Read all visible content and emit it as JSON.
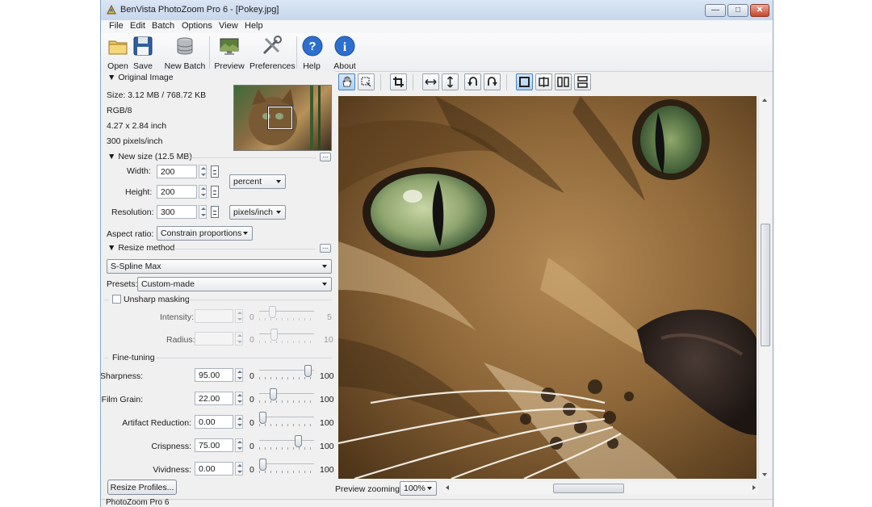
{
  "window": {
    "title": "BenVista PhotoZoom Pro 6 - [Pokey.jpg]"
  },
  "menu": [
    "File",
    "Edit",
    "Batch",
    "Options",
    "View",
    "Help"
  ],
  "toolbar": [
    {
      "label": "Open",
      "icon": "folder-icon"
    },
    {
      "label": "Save",
      "icon": "floppy-disk-icon"
    },
    {
      "label": "New Batch",
      "icon": "batch-stack-icon"
    },
    {
      "label": "Preview",
      "icon": "preview-monitor-icon"
    },
    {
      "label": "Preferences",
      "icon": "tools-icon"
    },
    {
      "label": "Help",
      "icon": "question-icon"
    },
    {
      "label": "About",
      "icon": "info-icon"
    }
  ],
  "original": {
    "header": "Original Image",
    "size": "Size: 3.12 MB / 768.72 KB",
    "mode": "RGB/8",
    "dimensions": "4.27 x 2.84 inch",
    "resolution": "300 pixels/inch"
  },
  "newsize": {
    "header": "New size (12.5 MB)",
    "width_label": "Width:",
    "width": "200",
    "height_label": "Height:",
    "height": "200",
    "resolution_label": "Resolution:",
    "resolution": "300",
    "unit": "percent",
    "res_unit": "pixels/inch",
    "aspect_label": "Aspect ratio:",
    "aspect": "Constrain proportions"
  },
  "resize": {
    "header": "Resize method",
    "method": "S-Spline Max",
    "presets_label": "Presets:",
    "preset": "Custom-made"
  },
  "unsharp": {
    "label": "Unsharp masking",
    "checked": false,
    "intensity_label": "Intensity:",
    "intensity_min": "0",
    "intensity_max": "5",
    "radius_label": "Radius:",
    "radius_min": "0",
    "radius_max": "10"
  },
  "finetuning": {
    "header": "Fine-tuning",
    "rows": [
      {
        "label": "Sharpness:",
        "value": "95.00",
        "min": "0",
        "max": "100",
        "level": 0.95
      },
      {
        "label": "Film Grain:",
        "value": "22.00",
        "min": "0",
        "max": "100",
        "level": 0.22
      },
      {
        "label": "Artifact Reduction:",
        "value": "0.00",
        "min": "0",
        "max": "100",
        "level": 0
      },
      {
        "label": "Crispness:",
        "value": "75.00",
        "min": "0",
        "max": "100",
        "level": 0.75
      },
      {
        "label": "Vividness:",
        "value": "0.00",
        "min": "0",
        "max": "100",
        "level": 0
      }
    ]
  },
  "resize_profiles": "Resize Profiles...",
  "preview_tools": [
    {
      "icon": "hand-pan-icon",
      "active": true
    },
    {
      "icon": "selection-icon",
      "active": false
    },
    {
      "icon": "crop-icon",
      "active": false
    },
    {
      "icon": "flip-horizontal-icon",
      "active": false
    },
    {
      "icon": "flip-vertical-icon",
      "active": false
    },
    {
      "icon": "rotate-left-icon",
      "active": false
    },
    {
      "icon": "rotate-right-icon",
      "active": false
    },
    {
      "icon": "single-view-icon",
      "active": true
    },
    {
      "icon": "split-view-icon",
      "active": false
    },
    {
      "icon": "side-by-side-icon",
      "active": false
    },
    {
      "icon": "stacked-view-icon",
      "active": false
    }
  ],
  "preview": {
    "zoom_label": "Preview zooming:",
    "zoom": "100%"
  },
  "status": "PhotoZoom Pro 6",
  "colors": {
    "title_bar": "#c7d7ec",
    "toolbar_active": "#acd0f4"
  }
}
